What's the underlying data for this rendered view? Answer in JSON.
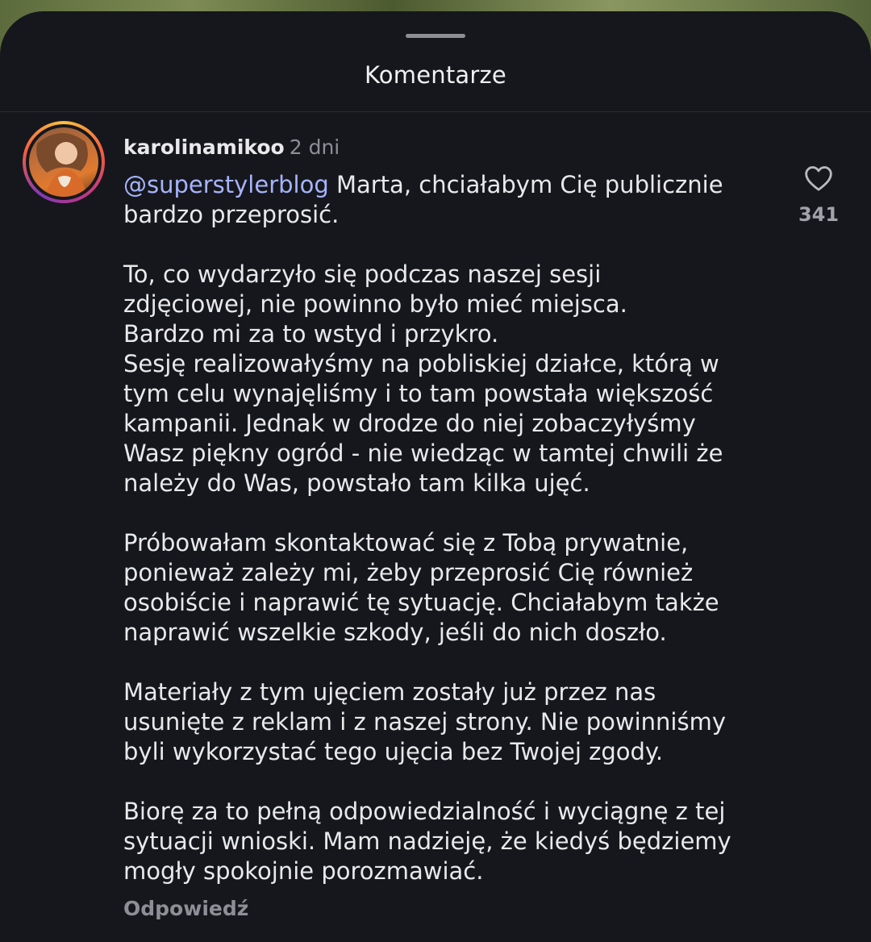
{
  "sheet": {
    "title": "Komentarze"
  },
  "comment": {
    "username": "karolinamikoo",
    "time": "2 dni",
    "mention": "@superstylerblog",
    "text": " Marta, chciałabym Cię publicznie\nbardzo przeprosić.\n\nTo, co wydarzyło się podczas naszej sesji\nzdjęciowej, nie powinno było mieć miejsca.\nBardzo mi za to wstyd i przykro.\nSesję realizowałyśmy na pobliskiej działce, którą w\ntym celu wynajęliśmy i to tam powstała większość\nkampanii. Jednak w drodze do niej zobaczyłyśmy\nWasz piękny ogród - nie wiedząc w tamtej chwili że\nnależy do Was, powstało tam kilka ujęć.\n\nPróbowałam skontaktować się z Tobą prywatnie,\nponieważ zależy mi, żeby przeprosić Cię również\nosobiście i naprawić tę sytuację. Chciałabym także\nnaprawić wszelkie szkody, jeśli do nich doszło.\n\nMateriały z tym ujęciem zostały już przez nas\nusunięte z reklam i z naszej strony. Nie powinniśmy\nbyli wykorzystać tego ujęcia bez Twojej zgody.\n\nBiorę za to pełną odpowiedzialność i wyciągnę z tej\nsytuacji wnioski. Mam nadzieję, że kiedyś będziemy\nmogły spokojnie porozmawiać.",
    "reply_label": "Odpowiedź",
    "like_count": "341",
    "like_icon": "heart-outline-icon"
  },
  "colors": {
    "sheet_bg": "#16171c",
    "text": "#e9e9ec",
    "muted": "#8e8f96",
    "mention": "#a6b4ff"
  }
}
